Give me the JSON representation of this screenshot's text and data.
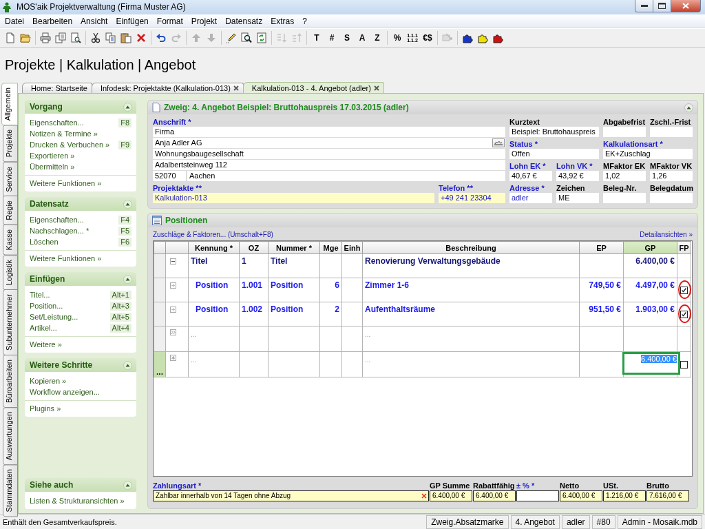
{
  "window": {
    "title": "MOS'aik Projektverwaltung (Firma Muster AG)"
  },
  "menu": [
    "Datei",
    "Bearbeiten",
    "Ansicht",
    "Einfügen",
    "Format",
    "Projekt",
    "Datensatz",
    "Extras",
    "?"
  ],
  "toolbar": [
    [
      {
        "kind": "new",
        "disabled": false
      },
      {
        "kind": "open",
        "disabled": false
      }
    ],
    [
      {
        "kind": "print",
        "disabled": false
      },
      {
        "kind": "pages",
        "disabled": false
      },
      {
        "kind": "preview",
        "disabled": false
      }
    ],
    [
      {
        "kind": "cut",
        "disabled": false
      },
      {
        "kind": "copy",
        "disabled": false
      },
      {
        "kind": "paste",
        "disabled": false
      },
      {
        "kind": "delete",
        "disabled": false
      }
    ],
    [
      {
        "kind": "undo",
        "disabled": false
      },
      {
        "kind": "redo",
        "disabled": true
      }
    ],
    [
      {
        "kind": "up",
        "disabled": true
      },
      {
        "kind": "down",
        "disabled": true
      }
    ],
    [
      {
        "kind": "edit",
        "disabled": false
      },
      {
        "kind": "find",
        "disabled": false
      },
      {
        "kind": "refresh",
        "disabled": false
      }
    ],
    [
      {
        "kind": "sortup",
        "disabled": true
      },
      {
        "kind": "sortdown",
        "disabled": true
      }
    ],
    [
      {
        "kind": "glyph",
        "text": "T",
        "disabled": false
      },
      {
        "kind": "glyph",
        "text": "#",
        "disabled": false
      },
      {
        "kind": "glyph",
        "text": "S",
        "disabled": false
      },
      {
        "kind": "glyph",
        "text": "A",
        "disabled": false
      },
      {
        "kind": "glyph",
        "text": "Z",
        "disabled": false
      }
    ],
    [
      {
        "kind": "glyph",
        "text": "%",
        "disabled": false
      },
      {
        "kind": "stack",
        "lines": [
          "1.1.1",
          "1.1.2"
        ],
        "disabled": false
      },
      {
        "kind": "glyph",
        "text": "€$",
        "disabled": false
      }
    ],
    [
      {
        "kind": "transfer",
        "disabled": true
      }
    ],
    [
      {
        "kind": "puzzle",
        "color": "#1535c8",
        "disabled": false
      },
      {
        "kind": "puzzle",
        "color": "#f0e000",
        "disabled": false
      },
      {
        "kind": "puzzle",
        "color": "#d01010",
        "disabled": false
      }
    ]
  ],
  "heading": "Projekte | Kalkulation | Angebot",
  "side_tabs": [
    {
      "label": "Allgemein",
      "selected": true
    },
    {
      "label": "Projekte",
      "selected": false
    },
    {
      "label": "Service",
      "selected": false
    },
    {
      "label": "Regie",
      "selected": false
    },
    {
      "label": "Kasse",
      "selected": false
    },
    {
      "label": "Logistik",
      "selected": false
    },
    {
      "label": "Subunternehmer",
      "selected": false
    },
    {
      "label": "Büroarbeiten",
      "selected": false
    },
    {
      "label": "Auswertungen",
      "selected": false
    },
    {
      "label": "Stammdaten",
      "selected": false
    }
  ],
  "doc_tabs": [
    {
      "label": "Home: Startseite",
      "closable": false,
      "selected": false
    },
    {
      "label": "Infodesk: Projektakte (Kalkulation-013)",
      "closable": true,
      "selected": false
    },
    {
      "label": "Kalkulation-013 - 4. Angebot (adler)",
      "closable": true,
      "selected": true
    }
  ],
  "task_panels": [
    {
      "title": "Vorgang",
      "expanded": true,
      "items": [
        {
          "label": "Eigenschaften...",
          "shortcut": "F8"
        },
        {
          "label": "Notizen & Termine »"
        },
        {
          "label": "Drucken & Verbuchen »",
          "shortcut": "F9"
        },
        {
          "label": "Exportieren »"
        },
        {
          "label": "Übermitteln »"
        }
      ],
      "more": [
        "Weitere Funktionen »"
      ]
    },
    {
      "title": "Datensatz",
      "expanded": true,
      "items": [
        {
          "label": "Eigenschaften...",
          "shortcut": "F4"
        },
        {
          "label": "Nachschlagen... *",
          "shortcut": "F5"
        },
        {
          "label": "Löschen",
          "shortcut": "F6"
        }
      ],
      "more": [
        "Weitere Funktionen »"
      ]
    },
    {
      "title": "Einfügen",
      "expanded": true,
      "items": [
        {
          "label": "Titel...",
          "shortcut": "Alt+1"
        },
        {
          "label": "Position...",
          "shortcut": "Alt+3"
        },
        {
          "label": "Set/Leistung...",
          "shortcut": "Alt+5"
        },
        {
          "label": "Artikel...",
          "shortcut": "Alt+4"
        }
      ],
      "more": [
        "Weitere »"
      ]
    },
    {
      "title": "Weitere Schritte",
      "expanded": true,
      "items": [
        {
          "label": "Kopieren »"
        },
        {
          "label": "Workflow anzeigen..."
        }
      ],
      "more": [
        "Plugins »"
      ]
    },
    {
      "title": "Siehe auch",
      "expanded": true,
      "items": [
        {
          "label": "Listen & Strukturansichten »"
        }
      ]
    }
  ],
  "branch": {
    "title": "Zweig: 4. Angebot Beispiel: Bruttohauspreis 17.03.2015 (adler)",
    "address": {
      "label": "Anschrift *",
      "required": true,
      "lines": [
        "Firma",
        "Anja Adler AG",
        "Wohnungsbaugesellschaft",
        "Adalbertsteinweg 112"
      ],
      "zip": "52070",
      "city": "Aachen"
    },
    "project_file": {
      "label": "Projektakte **",
      "value": "Kalkulation-013",
      "required": true,
      "highlighted": true
    },
    "phone": {
      "label": "Telefon **",
      "value": "+49 241 23304",
      "required": true,
      "highlighted": true
    },
    "fields": [
      {
        "label": "Kurztext",
        "value": "Beispiel: Bruttohauspreis",
        "required": false,
        "linked": false
      },
      {
        "label": "Abgabefrist",
        "required": false
      },
      {
        "label": "Zschl.-Frist",
        "required": false
      },
      {
        "label": "Status *",
        "value": "Offen",
        "required": true,
        "linked": false
      },
      {
        "label": "Kalkulationsart *",
        "value": "EK+Zuschlag",
        "required": true,
        "linked": false
      },
      {
        "label": "Lohn EK *",
        "value": "40,67 €",
        "required": true,
        "linked": false
      },
      {
        "label": "Lohn VK *",
        "value": "43,92 €",
        "required": true,
        "linked": false
      },
      {
        "label": "MFaktor EK",
        "value": "1,02",
        "required": false,
        "linked": false
      },
      {
        "label": "MFaktor VK",
        "value": "1,26",
        "required": false,
        "linked": false
      },
      {
        "label": "Adresse *",
        "value": "adler",
        "required": true,
        "linked": true
      },
      {
        "label": "Zeichen",
        "value": "ME",
        "required": false,
        "linked": false
      },
      {
        "label": "Beleg-Nr.",
        "required": false
      },
      {
        "label": "Belegdatum",
        "required": false
      }
    ]
  },
  "positions": {
    "title": "Positionen",
    "link": "Zuschläge & Faktoren... (Umschalt+F8)",
    "details_link": "Detailansichten »",
    "columns": [
      {
        "label": "Kennung *",
        "selected": false
      },
      {
        "label": "OZ",
        "selected": false
      },
      {
        "label": "Nummer *",
        "selected": false
      },
      {
        "label": "Mge",
        "selected": false
      },
      {
        "label": "Einh",
        "selected": false
      },
      {
        "label": "Beschreibung",
        "selected": false
      },
      {
        "label": "EP",
        "selected": false
      },
      {
        "label": "GP",
        "selected": true
      },
      {
        "label": "FP",
        "selected": false
      }
    ],
    "rows": [
      {
        "kind": "title",
        "selected": false,
        "expanded": true,
        "kennung": "Titel",
        "oz": "1",
        "nummer": "Titel",
        "beschreibung": "Renovierung Verwaltungsgebäude",
        "gp": "6.400,00 €"
      },
      {
        "kind": "position",
        "selected": false,
        "expanded": false,
        "kennung": "Position",
        "oz": "1.001",
        "nummer": "Position",
        "mge": "6",
        "beschreibung": "Zimmer 1-6",
        "ep": "749,50 €",
        "gp": "4.497,00 €",
        "fp": true,
        "circled": true
      },
      {
        "kind": "position",
        "selected": false,
        "expanded": false,
        "kennung": "Position",
        "oz": "1.002",
        "nummer": "Position",
        "mge": "2",
        "beschreibung": "Aufenthaltsräume",
        "ep": "951,50 €",
        "gp": "1.903,00 €",
        "fp": true,
        "circled": true
      },
      {
        "kind": "placeholder",
        "selected": false,
        "kennung": "...",
        "beschreibung": "..."
      },
      {
        "kind": "new",
        "selected": true,
        "marker": "...",
        "kennung": "...",
        "beschreibung": "...",
        "gp": "6.400,00 €",
        "fp": false,
        "circled": false
      }
    ]
  },
  "summary": {
    "payment": {
      "label": "Zahlungsart *",
      "value": "Zahlbar innerhalb von 14 Tagen ohne Abzug",
      "required": true
    },
    "totals": [
      {
        "label": "GP Summe",
        "value": "6.400,00 €",
        "required": false,
        "highlighted": true
      },
      {
        "label": "Rabattfähig",
        "value": "6.400,00 €",
        "required": false,
        "highlighted": true
      },
      {
        "label": "± % *",
        "required": true,
        "highlighted": false
      },
      {
        "label": "Netto",
        "value": "6.400,00 €",
        "required": false,
        "highlighted": true
      },
      {
        "label": "USt.",
        "value": "1.216,00 €",
        "required": false,
        "highlighted": true
      },
      {
        "label": "Brutto",
        "value": "7.616,00 €",
        "required": false,
        "highlighted": true
      }
    ]
  },
  "status_bar": {
    "message": "Enthält den Gesamtverkaufspreis.",
    "panes": [
      "Zweig.Absatzmarke",
      "4. Angebot",
      "adler",
      "#80",
      "Admin - Mosaik.mdb"
    ]
  }
}
